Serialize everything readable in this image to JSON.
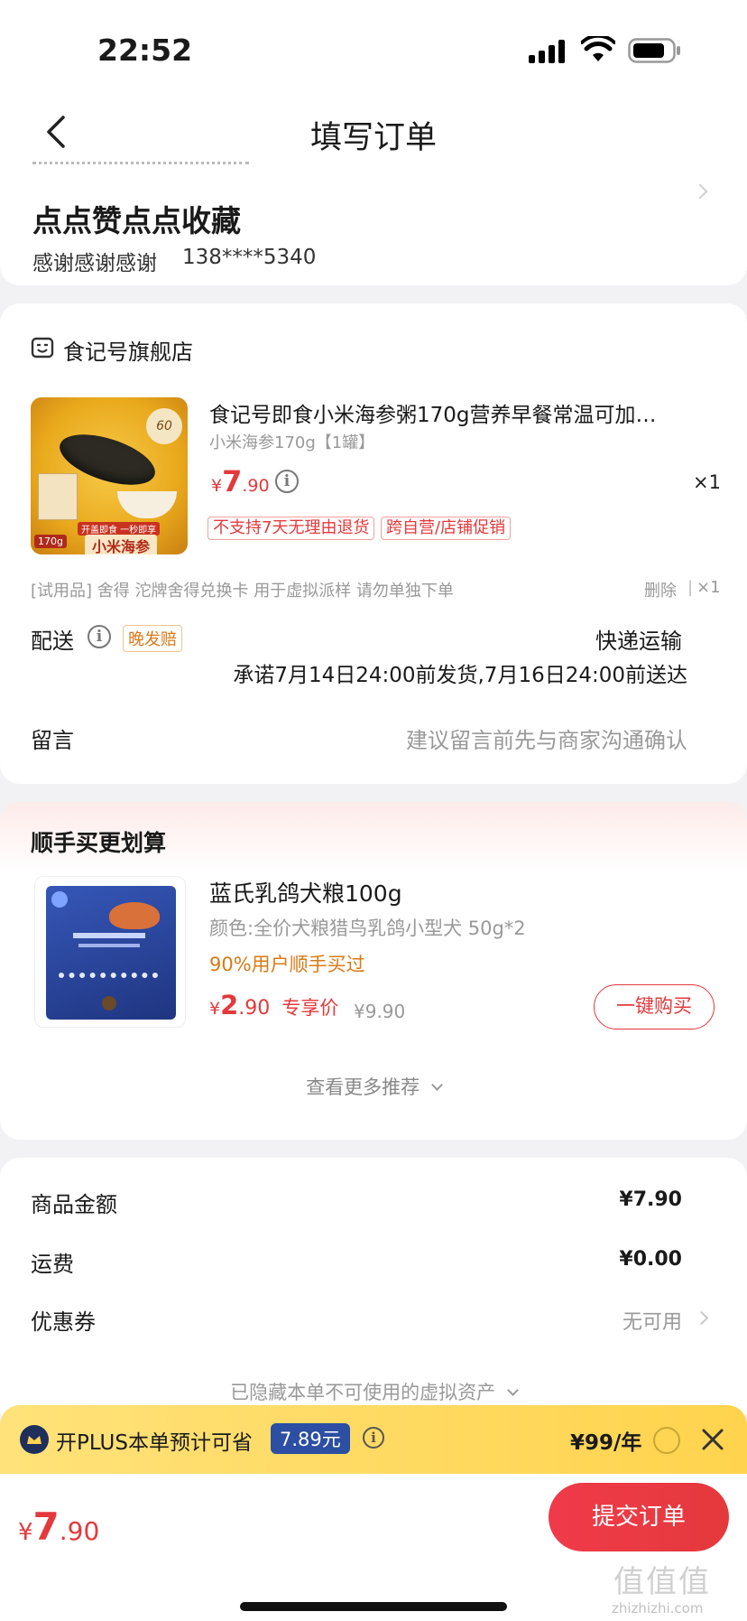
{
  "status_bar": {
    "time": "22:52"
  },
  "header": {
    "title": "填写订单"
  },
  "address": {
    "name": "点点赞点点收藏",
    "recipient": "感谢感谢感谢",
    "phone": "138****5340"
  },
  "shop": {
    "name": "食记号旗舰店",
    "product": {
      "title": "食记号即食小米海参粥170g营养早餐常温可加…",
      "spec": "小米海参170g【1罐】",
      "price_symbol": "¥",
      "price_int": "7",
      "price_dec": ".90",
      "qty": "×1",
      "tags": [
        "不支持7天无理由退货",
        "跨自营/店铺促销"
      ],
      "image_badge_top": "60",
      "image_badge_weight": "170g",
      "image_name": "小米海参",
      "image_slogan": "开盖即食 一秒即享"
    },
    "trial": {
      "text": "[试用品] 舍得 沱牌舍得兑换卡 用于虚拟派样 请勿单独下单",
      "delete": "删除",
      "divider": "|",
      "qty": "×1"
    },
    "delivery": {
      "label": "配送",
      "badge": "晚发赔",
      "method": "快递运输",
      "promise": "承诺7月14日24:00前发货,7月16日24:00前送达"
    },
    "message": {
      "label": "留言",
      "placeholder": "建议留言前先与商家沟通确认"
    }
  },
  "recommend": {
    "title": "顺手买更划算",
    "item": {
      "name": "蓝氏乳鸽犬粮100g",
      "spec": "颜色:全价犬粮猎鸟乳鸽小型犬 50g*2",
      "social": "90%用户顺手买过",
      "price_symbol": "¥",
      "price_int": "2",
      "price_dec": ".90",
      "price_label": "专享价",
      "orig_price": "¥9.90",
      "buy_button": "一键购买"
    },
    "more": "查看更多推荐"
  },
  "summary": {
    "rows": [
      {
        "label": "商品金额",
        "value": "¥7.90"
      },
      {
        "label": "运费",
        "value": "¥0.00"
      },
      {
        "label": "优惠券",
        "value": "无可用"
      }
    ],
    "hidden_assets": "已隐藏本单不可使用的虚拟资产"
  },
  "plus_bar": {
    "text": "开PLUS本单预计可省",
    "save_amount": "7.89元",
    "price": "¥99/年"
  },
  "footer": {
    "price_symbol": "¥",
    "price_int": "7",
    "price_dec": ".90",
    "submit": "提交订单"
  },
  "watermark": {
    "logo": "值值值",
    "domain": "zhizhizhi.com"
  },
  "colors": {
    "accent": "#e4393c",
    "plus_bar": "#ffd34d",
    "plus_badge": "#2c4ea3",
    "recommend_orange": "#d97a16"
  }
}
